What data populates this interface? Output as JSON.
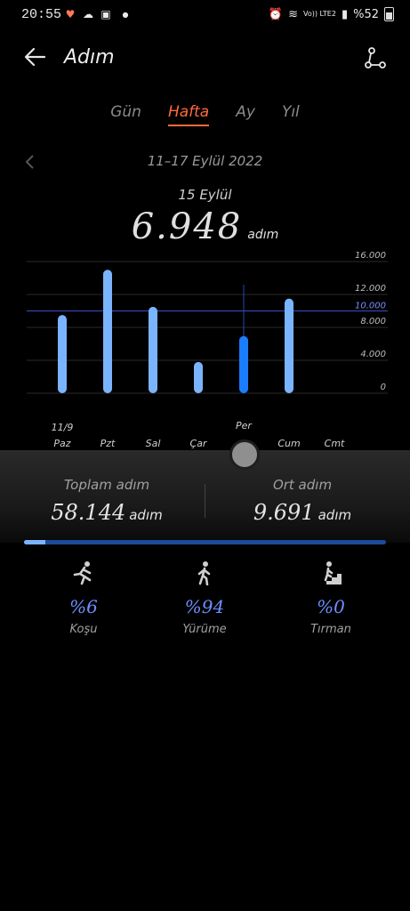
{
  "status_bar": {
    "time": "20:55",
    "network": "Vo)) LTE2",
    "battery": "%52"
  },
  "header": {
    "title": "Adım",
    "back_icon": "arrow-left-icon",
    "share_icon": "share-icon"
  },
  "tabs": [
    {
      "label": "Gün",
      "active": false
    },
    {
      "label": "Hafta",
      "active": true
    },
    {
      "label": "Ay",
      "active": false
    },
    {
      "label": "Yıl",
      "active": false
    }
  ],
  "range": {
    "label": "11–17 Eylül 2022"
  },
  "selected": {
    "date": "15 Eylül",
    "steps": "6.948",
    "unit": "adım"
  },
  "chart_data": {
    "type": "bar",
    "categories": [
      "Paz",
      "Pzt",
      "Sal",
      "Çar",
      "Per",
      "Cum",
      "Cmt"
    ],
    "first_category_date": "11/9",
    "values": [
      9500,
      15000,
      10500,
      3800,
      6948,
      11500,
      0
    ],
    "selected_index": 4,
    "y_ticks": [
      0,
      4000,
      8000,
      12000,
      16000
    ],
    "y_tick_labels": [
      "0",
      "4.000",
      "8.000",
      "12.000",
      "16.000"
    ],
    "goal": 10000,
    "goal_label": "10.000",
    "ylim": [
      0,
      16000
    ],
    "colors": {
      "bar": "#7ab4ff",
      "selected_bar": "#1a7dff",
      "goal_line": "#3a4fc8"
    }
  },
  "summary": {
    "total_label": "Toplam adım",
    "total_value": "58.144",
    "total_unit": "adım",
    "avg_label": "Ort adım",
    "avg_value": "9.691",
    "avg_unit": "adım",
    "running_fraction": 0.06
  },
  "activities": [
    {
      "icon": "running-icon",
      "percent": "%6",
      "name": "Koşu"
    },
    {
      "icon": "walking-icon",
      "percent": "%94",
      "name": "Yürüme"
    },
    {
      "icon": "stairs-climbing-icon",
      "percent": "%0",
      "name": "Tırman"
    }
  ]
}
